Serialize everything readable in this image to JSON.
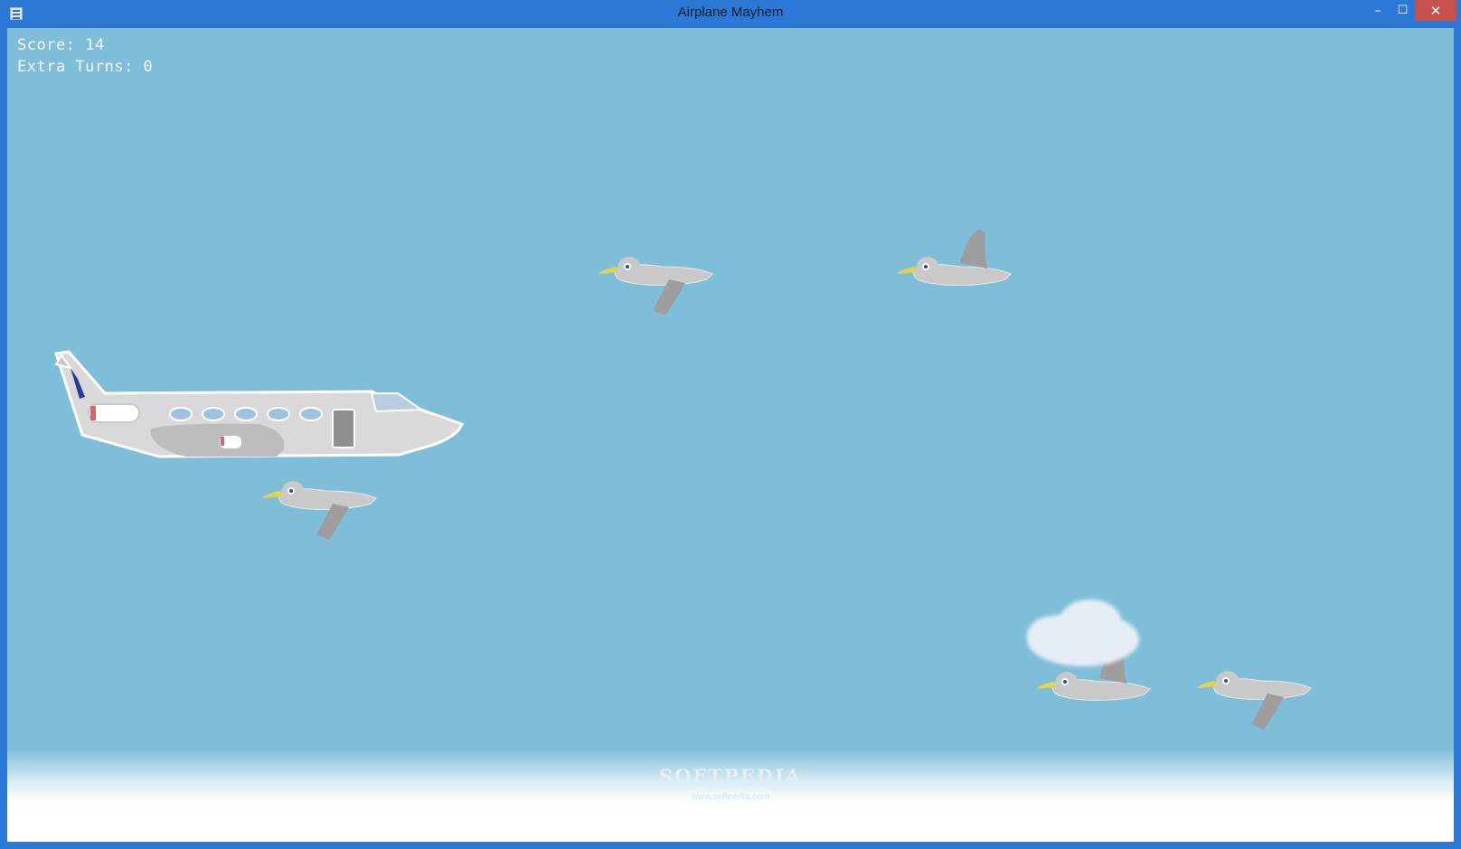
{
  "window": {
    "title": "Airplane Mayhem",
    "icons": {
      "app": "app-icon",
      "minimize": "minimize-icon",
      "maximize": "maximize-icon",
      "close": "close-icon"
    },
    "controls": {
      "minimize_glyph": "–",
      "maximize_glyph": "☐",
      "close_glyph": "✕"
    }
  },
  "hud": {
    "score_label": "Score: 14",
    "extra_turns_label": "Extra Turns: 0"
  },
  "colors": {
    "title_bar": "#2b78d6",
    "close_button": "#c7504a",
    "sky": "#7fbed9",
    "ground": "#ffffff",
    "plane_body": "#d9d9d9",
    "bird_body": "#c8c8c8",
    "bird_beak": "#e6d24a"
  },
  "watermark": {
    "logo": "SOFTPEDIA",
    "url": "www.softpedia.com"
  }
}
